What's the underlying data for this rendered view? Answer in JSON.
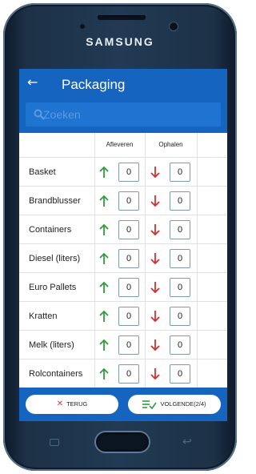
{
  "device": {
    "brand": "SAMSUNG"
  },
  "app": {
    "title": "Packaging",
    "search": {
      "placeholder": "Zoeken",
      "value": ""
    }
  },
  "table": {
    "columns": {
      "deliver": "Afleveren",
      "pickup": "Ophalen"
    },
    "rows": [
      {
        "label": "Basket",
        "deliver": "0",
        "pickup": "0"
      },
      {
        "label": "Brandblusser",
        "deliver": "0",
        "pickup": "0"
      },
      {
        "label": "Containers",
        "deliver": "0",
        "pickup": "0"
      },
      {
        "label": "Diesel (liters)",
        "deliver": "0",
        "pickup": "0"
      },
      {
        "label": "Euro Pallets",
        "deliver": "0",
        "pickup": "0"
      },
      {
        "label": "Kratten",
        "deliver": "0",
        "pickup": "0"
      },
      {
        "label": "Melk (liters)",
        "deliver": "0",
        "pickup": "0"
      },
      {
        "label": "Rolcontainers",
        "deliver": "0",
        "pickup": "0"
      }
    ]
  },
  "footer": {
    "back_label": "TERUG",
    "next_label": "VOLGENDE(2/4)"
  },
  "colors": {
    "primary": "#1565c0",
    "up_arrow": "#2e9e3a",
    "down_arrow": "#d32f2f",
    "cancel": "#e03c31"
  },
  "icons": {
    "back": "arrow-left-icon",
    "search": "search-icon",
    "deliver": "arrow-up-icon",
    "pickup": "arrow-down-icon",
    "cancel": "x-icon",
    "next": "checklist-icon"
  }
}
